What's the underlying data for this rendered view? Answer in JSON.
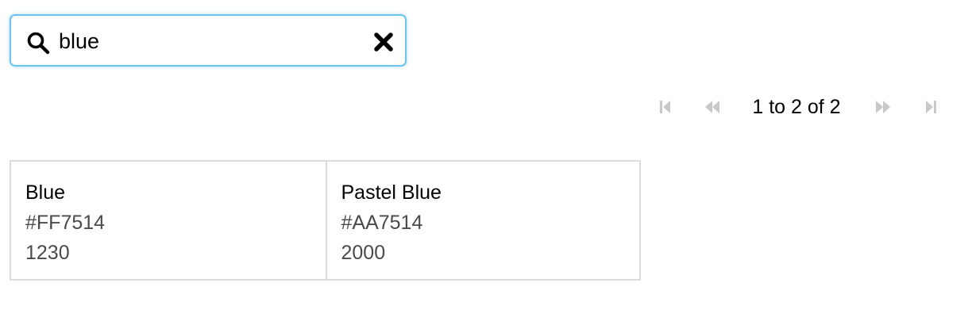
{
  "search": {
    "value": "blue",
    "placeholder": "",
    "accent_color": "#6cc3ee"
  },
  "icons": {
    "search": "search-icon",
    "clear": "close-icon",
    "first": "first-page-icon",
    "prev": "previous-page-icon",
    "next": "next-page-icon",
    "last": "last-page-icon"
  },
  "pagination": {
    "summary": "1 to 2 of 2",
    "disabled_color": "#c8c8c8"
  },
  "results": [
    {
      "name": "Blue",
      "hex": "#FF7514",
      "value": "1230"
    },
    {
      "name": "Pastel Blue",
      "hex": "#AA7514",
      "value": "2000"
    }
  ]
}
